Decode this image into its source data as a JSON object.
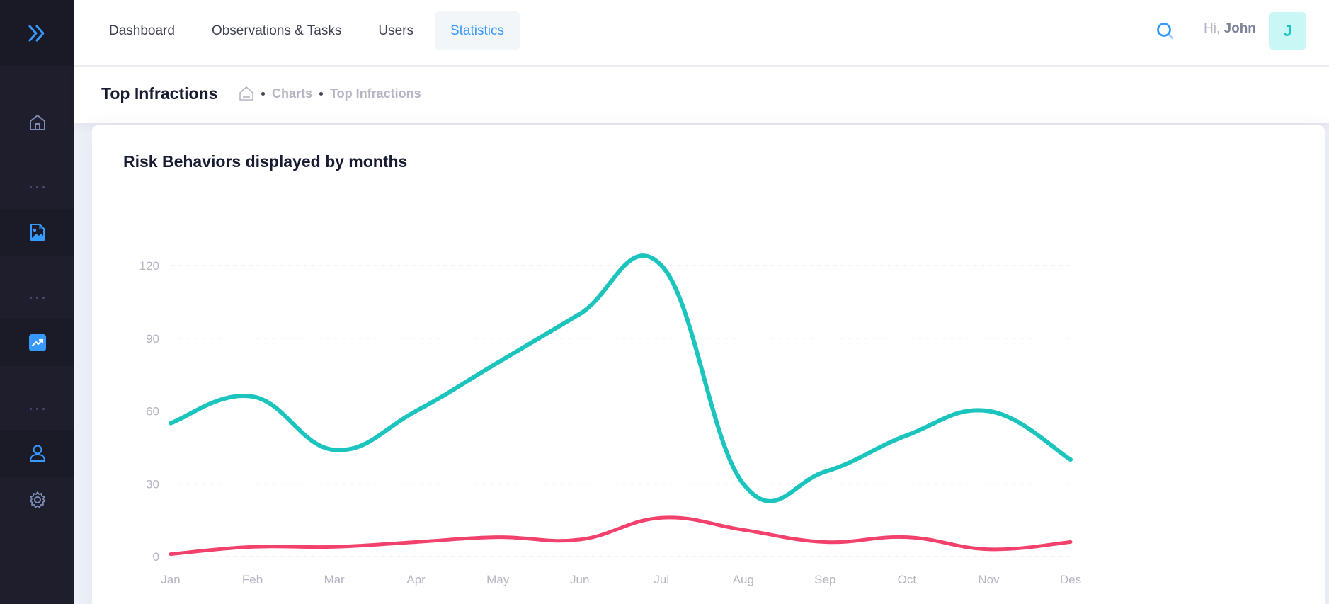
{
  "topnav": {
    "tabs": [
      {
        "label": "Dashboard"
      },
      {
        "label": "Observations & Tasks"
      },
      {
        "label": "Users"
      },
      {
        "label": "Statistics"
      }
    ],
    "active_tab": "Statistics"
  },
  "user": {
    "greeting": "Hi,",
    "name": "John",
    "initial": "J"
  },
  "subheader": {
    "title": "Top Infractions",
    "breadcrumb": [
      "Charts",
      "Top Infractions"
    ]
  },
  "sidebar": {
    "icons": [
      "home-icon",
      "image-file-icon",
      "chart-icon",
      "user-icon",
      "gear-icon"
    ],
    "active": "chart-icon"
  },
  "colors": {
    "accent": "#3699ff",
    "series_teal": "#1bc5bd",
    "series_red": "#f1416c"
  },
  "card": {
    "title": "Risk Behaviors displayed by months"
  },
  "chart_data": {
    "type": "line",
    "title": "Risk Behaviors displayed by months",
    "categories": [
      "Jan",
      "Feb",
      "Mar",
      "Apr",
      "May",
      "Jun",
      "Jul",
      "Aug",
      "Sep",
      "Oct",
      "Nov",
      "Des"
    ],
    "series": [
      {
        "values": [
          55,
          66,
          44,
          60,
          80,
          100,
          120,
          30,
          35,
          50,
          60,
          40
        ],
        "color": "#1bc5bd"
      },
      {
        "values": [
          1,
          4,
          4,
          6,
          8,
          7,
          16,
          11,
          6,
          8,
          3,
          6
        ],
        "color": "#f1416c"
      }
    ],
    "yticks": [
      0,
      30,
      60,
      90,
      120
    ],
    "ylim": [
      0,
      120
    ],
    "grid": true,
    "smooth": true
  }
}
